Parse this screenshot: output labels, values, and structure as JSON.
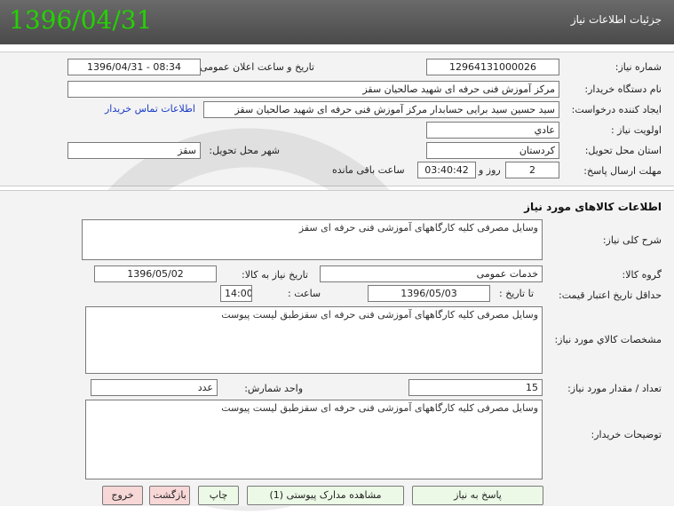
{
  "header": {
    "title": "جزئیات اطلاعات نیاز",
    "date": "1396/04/31"
  },
  "need_number": {
    "label": "شماره نیاز:",
    "value": "12964131000026"
  },
  "announce": {
    "label": "تاریخ و ساعت اعلان عمومی:",
    "value": "1396/04/31 - 08:34"
  },
  "buyer": {
    "label": "نام دستگاه خریدار:",
    "value": "مرکز آموزش فنی حرفه ای شهید صالحیان سقز"
  },
  "requester": {
    "label": "ایجاد کننده درخواست:",
    "value": "سید حسین  سید برایی حسابدار مرکز آموزش فنی حرفه ای شهید صالحیان سقز",
    "contact_link": "اطلاعات تماس خریدار"
  },
  "priority": {
    "label": "اولویت نیاز :",
    "value": "عادي"
  },
  "province": {
    "label": "استان محل تحویل:",
    "value": "کردستان"
  },
  "city": {
    "label": "شهر محل تحویل:",
    "value": "سقز"
  },
  "deadline": {
    "label": "مهلت ارسال پاسخ:",
    "days": "2",
    "days_label": "روز و",
    "time": "03:40:42",
    "remaining_label": "ساعت باقی مانده"
  },
  "goods_section": {
    "title": "اطلاعات کالاهای مورد نیاز"
  },
  "general_desc": {
    "label": "شرح کلی نیاز:",
    "value": "وسایل مصرفی کلیه کارگاههای آموزشی فنی حرفه ای سقز"
  },
  "goods_group": {
    "label": "گروه کالا:",
    "value": "خدمات عمومی"
  },
  "need_date": {
    "label": "تاریخ نیاز به کالا:",
    "value": "1396/05/02"
  },
  "validity": {
    "label": "حداقل تاریخ اعتبار قیمت:",
    "to_date_label": "تا تاریخ :",
    "date": "1396/05/03",
    "time_label": "ساعت :",
    "time": "14:00"
  },
  "specs": {
    "label": "مشخصات کالاي مورد نیاز:",
    "value": "وسایل مصرفی کلیه کارگاههای آموزشی فنی حرفه ای سقزطبق لیست پیوست"
  },
  "quantity": {
    "label": "تعداد / مقدار مورد نیاز:",
    "value": "15"
  },
  "unit": {
    "label": "واحد شمارش:",
    "value": "عدد"
  },
  "buyer_notes": {
    "label": "توضیحات خریدار:",
    "value": "وسایل مصرفی کلیه کارگاههای آموزشی فنی حرفه ای سقزطبق لیست پیوست"
  },
  "buttons": {
    "reply": "پاسخ به نیاز",
    "attachments": "مشاهده مدارک پیوستی (1)",
    "print": "چاپ",
    "back": "بازگشت",
    "exit": "خروج"
  },
  "colors": {
    "header_bg": "#5a5a5a",
    "date_green": "#22d300",
    "link_blue": "#1a3cc8",
    "button_green": "#ecf9e6",
    "button_red": "#f8d7d7"
  }
}
